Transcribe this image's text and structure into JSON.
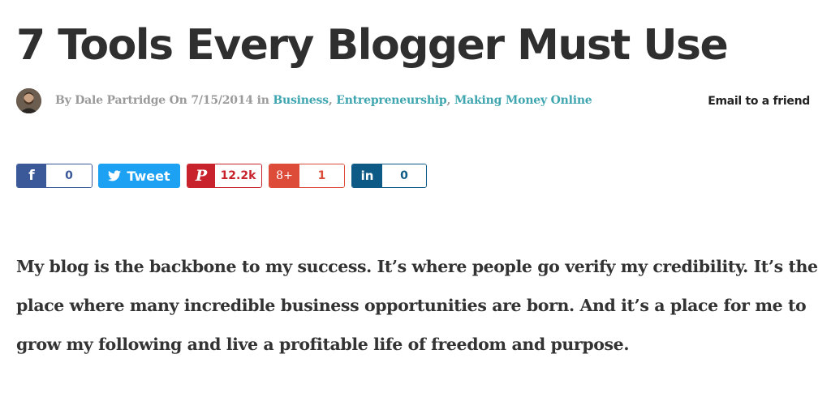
{
  "article": {
    "title": "7 Tools Every Blogger Must Use",
    "byline": {
      "prefix": "By Dale Partridge On 7/15/2014 in ",
      "categories": [
        "Business",
        "Entrepreneurship",
        "Making Money Online"
      ],
      "separator": ", "
    },
    "email_friend": "Email to a friend",
    "body": "My blog is the backbone to my success. It’s where people go verify my credibility. It’s the place where many incredible business opportunities are born. And it’s a place for me to grow my following and live a profitable life of freedom and purpose."
  },
  "share": {
    "facebook": {
      "icon": "f",
      "count": "0",
      "color": "#3b5998"
    },
    "twitter": {
      "icon": "twitter-bird-icon",
      "label": "Tweet",
      "color": "#1da1f2"
    },
    "pinterest": {
      "icon": "P",
      "count": "12.2k",
      "color": "#c8232c"
    },
    "googleplus": {
      "icon": "8+",
      "count": "1",
      "color": "#dd4b39"
    },
    "linkedin": {
      "icon": "in",
      "count": "0",
      "color": "#0e5a86"
    }
  }
}
